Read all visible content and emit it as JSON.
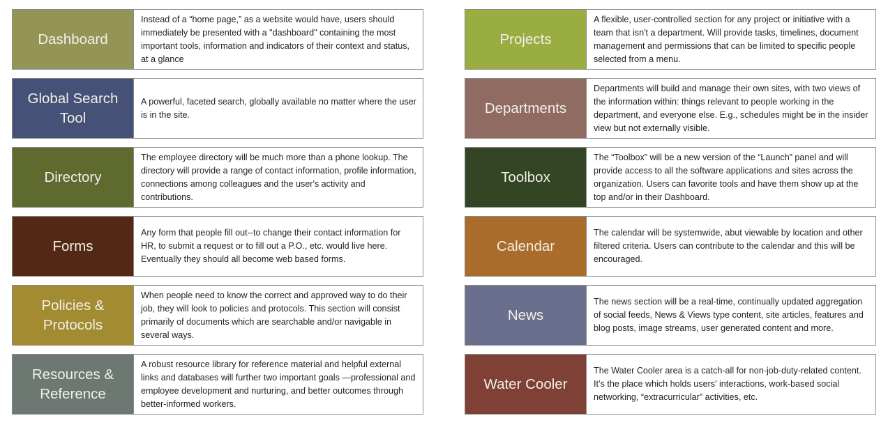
{
  "sections": {
    "left": [
      {
        "title": "Dashboard",
        "color": "#959457",
        "description": "Instead of a “home page,” as a website would have, users should immediately be presented with a \"dashboard\" containing the most important tools, information and indicators of their context and status, at a glance"
      },
      {
        "title": "Global Search Tool",
        "color": "#455177",
        "description": "A powerful, faceted search, globally available no matter where the user is in the site."
      },
      {
        "title": "Directory",
        "color": "#5f6a2e",
        "description": "The employee directory will be much more than a phone lookup.  The directory will provide a range of contact information, profile information, connections among colleagues and the user's activity and contributions."
      },
      {
        "title": "Forms",
        "color": "#532915",
        "description": "Any form that people fill out--to change their contact information for HR, to submit a request or to fill out a P.O., etc. would live here. Eventually they should all become web based forms."
      },
      {
        "title": "Policies & Protocols",
        "color": "#a28b30",
        "description": "When people need to know the correct and approved way to do their job, they will look to policies and protocols. This section will consist primarily of documents which are searchable and/or navigable in several ways."
      },
      {
        "title": "Resources & Reference",
        "color": "#6d7872",
        "description": "A robust resource library for reference material and helpful external links and databases will further two important goals —professional and employee development and nurturing, and better outcomes through better-informed workers."
      }
    ],
    "right": [
      {
        "title": "Projects",
        "color": "#9aad41",
        "description": " A flexible, user-controlled section for any project or initiative with a team that isn't a department. Will provide tasks, timelines, document management and permissions that can be limited to specific people selected from a menu."
      },
      {
        "title": "Departments",
        "color": "#8f6b62",
        "description": "Departments will build and manage their own sites, with  two views of the information within: things relevant to people working in the department, and everyone else. E.g., schedules might be in the insider view but not externally visible."
      },
      {
        "title": "Toolbox",
        "color": "#344526",
        "description": "The “Toolbox” will be a new version of the “Launch” panel and will provide access to all the software applications and sites across the organization. Users can favorite tools and have them show up at the top and/or in their Dashboard."
      },
      {
        "title": "Calendar",
        "color": "#a96c2a",
        "description": "The calendar will be systemwide, abut viewable by location and other filtered criteria. Users can contribute to the calendar and this will be encouraged."
      },
      {
        "title": "News",
        "color": "#6b6f8e",
        "description": "The news section will be a real-time, continually updated aggregation of social feeds, News & Views type content, site articles, features and blog posts, image streams, user generated content and more."
      },
      {
        "title": "Water Cooler",
        "color": "#7f4035",
        "description": "The Water Cooler area is a catch-all for non-job-duty-related content. It’s the place which holds users' interactions, work-based social networking, “extracurricular” activities, etc."
      }
    ]
  }
}
